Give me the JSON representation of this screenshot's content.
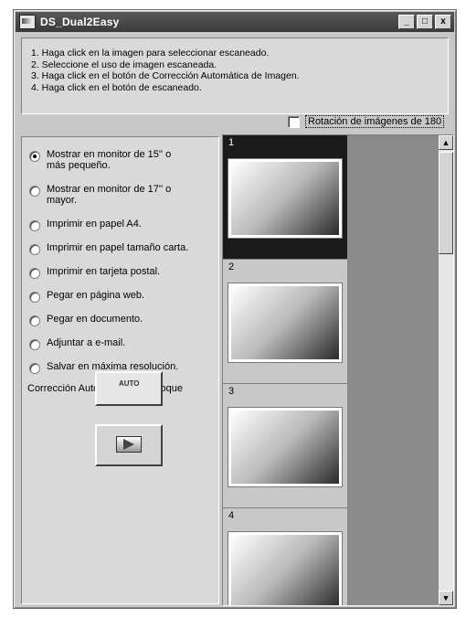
{
  "window": {
    "title": "DS_Dual2Easy",
    "controls": [
      "_",
      "□",
      "x"
    ]
  },
  "instructions": [
    "1. Haga click en la imagen para seleccionar escaneado.",
    "2. Seleccione el uso de imagen escaneada.",
    "3. Haga click en el botón de Corrección Automática de Imagen.",
    "4. Haga click en el botón de escaneado."
  ],
  "rotation": {
    "label": "Rotación de imágenes de 180",
    "checked": false
  },
  "options": [
    {
      "label": "Mostrar en monitor de 15'' o más pequeño.",
      "selected": true
    },
    {
      "label": "Mostrar en monitor de 17'' o mayor.",
      "selected": false
    },
    {
      "label": "Imprimir en papel A4.",
      "selected": false
    },
    {
      "label": "Imprimir en papel tamaño carta.",
      "selected": false
    },
    {
      "label": "Imprimir en tarjeta postal.",
      "selected": false
    },
    {
      "label": "Pegar en página web.",
      "selected": false
    },
    {
      "label": "Pegar en documento.",
      "selected": false
    },
    {
      "label": "Adjuntar a e-mail.",
      "selected": false
    },
    {
      "label": "Salvar en máxima resolución.",
      "selected": false
    }
  ],
  "focus": {
    "label": "Corrección Automática de Enfoque",
    "auto_button_text": "AUTO"
  },
  "thumbnails": [
    {
      "number": "1",
      "selected": true
    },
    {
      "number": "2",
      "selected": false
    },
    {
      "number": "3",
      "selected": false
    },
    {
      "number": "4",
      "selected": false
    }
  ],
  "icons": {
    "app": "scanner-icon",
    "auto": "auto-focus-icon",
    "scan": "scan-play-icon"
  },
  "colors": {
    "window": "#c8c8c8",
    "titlebar": "#3a3a3a",
    "selected_thumb": "#1a1a1a"
  }
}
